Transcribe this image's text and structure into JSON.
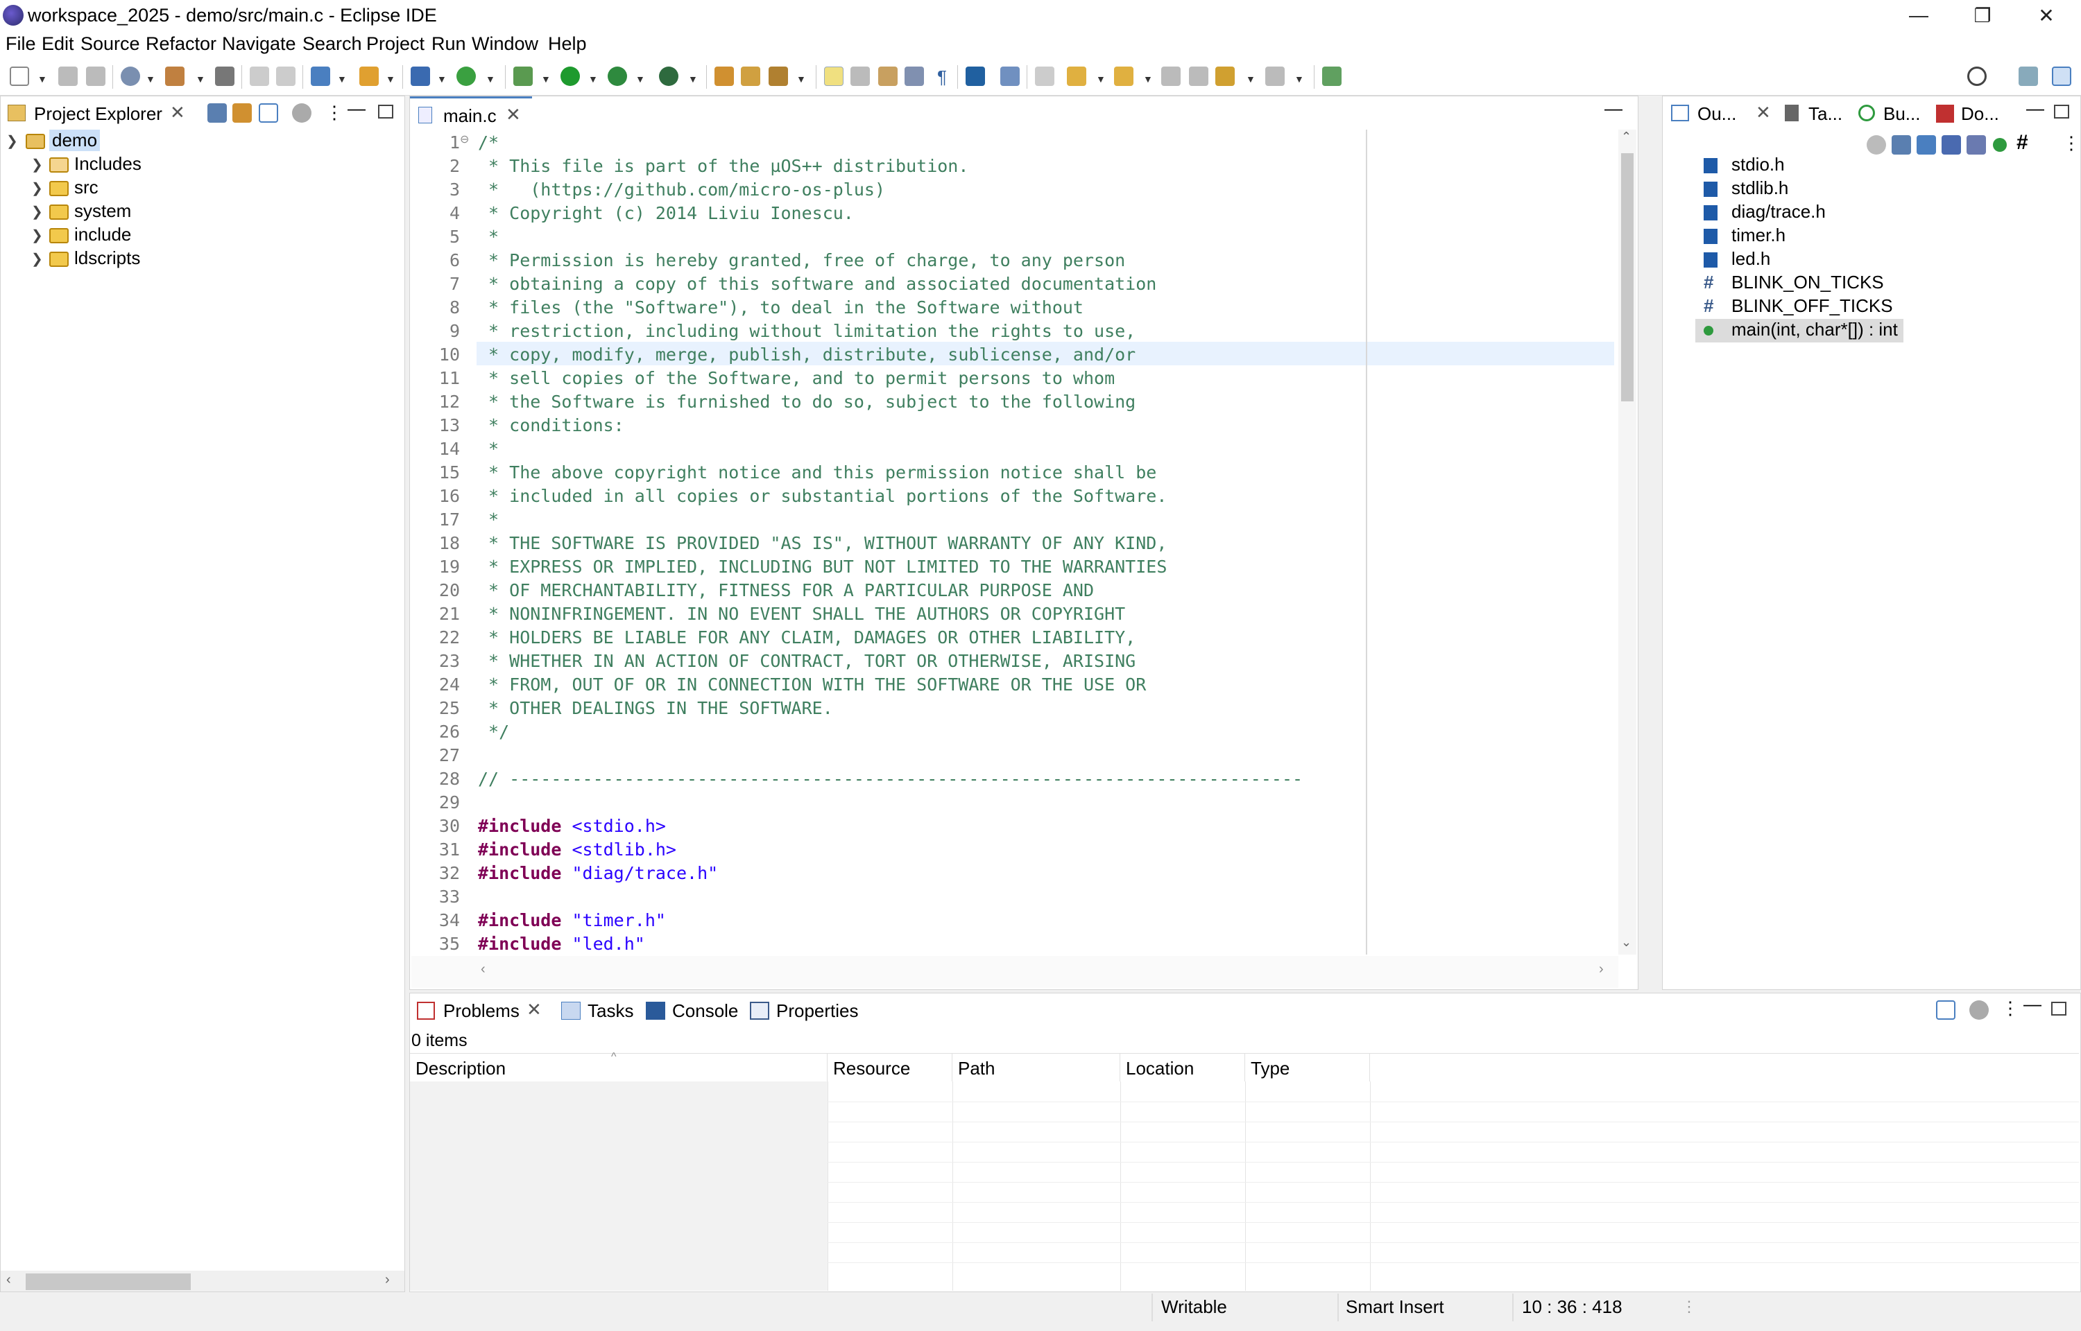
{
  "window": {
    "title": "workspace_2025 - demo/src/main.c - Eclipse IDE",
    "minimize": "—",
    "restore": "❐",
    "close": "✕"
  },
  "menu": [
    "File",
    "Edit",
    "Source",
    "Refactor",
    "Navigate",
    "Search",
    "Project",
    "Run",
    "Window",
    "Help"
  ],
  "project_explorer": {
    "tab_label": "Project Explorer",
    "tree": [
      {
        "label": "demo",
        "expanded": true
      },
      {
        "label": "Includes"
      },
      {
        "label": "src"
      },
      {
        "label": "system"
      },
      {
        "label": "include"
      },
      {
        "label": "ldscripts"
      }
    ]
  },
  "editor": {
    "tab_label": "main.c",
    "lines": [
      {
        "n": "1",
        "t": "/*",
        "c": "cmt"
      },
      {
        "n": "2",
        "t": " * This file is part of the µOS++ distribution.",
        "c": "cmt"
      },
      {
        "n": "3",
        "t": " *   (https://github.com/micro-os-plus)",
        "c": "cmt"
      },
      {
        "n": "4",
        "t": " * Copyright (c) 2014 Liviu Ionescu.",
        "c": "cmt"
      },
      {
        "n": "5",
        "t": " *",
        "c": "cmt"
      },
      {
        "n": "6",
        "t": " * Permission is hereby granted, free of charge, to any person",
        "c": "cmt"
      },
      {
        "n": "7",
        "t": " * obtaining a copy of this software and associated documentation",
        "c": "cmt"
      },
      {
        "n": "8",
        "t": " * files (the \"Software\"), to deal in the Software without",
        "c": "cmt"
      },
      {
        "n": "9",
        "t": " * restriction, including without limitation the rights to use,",
        "c": "cmt"
      },
      {
        "n": "10",
        "t": " * copy, modify, merge, publish, distribute, sublicense, and/or",
        "c": "cmt"
      },
      {
        "n": "11",
        "t": " * sell copies of the Software, and to permit persons to whom",
        "c": "cmt"
      },
      {
        "n": "12",
        "t": " * the Software is furnished to do so, subject to the following",
        "c": "cmt"
      },
      {
        "n": "13",
        "t": " * conditions:",
        "c": "cmt"
      },
      {
        "n": "14",
        "t": " *",
        "c": "cmt"
      },
      {
        "n": "15",
        "t": " * The above copyright notice and this permission notice shall be",
        "c": "cmt"
      },
      {
        "n": "16",
        "t": " * included in all copies or substantial portions of the Software.",
        "c": "cmt"
      },
      {
        "n": "17",
        "t": " *",
        "c": "cmt"
      },
      {
        "n": "18",
        "t": " * THE SOFTWARE IS PROVIDED \"AS IS\", WITHOUT WARRANTY OF ANY KIND,",
        "c": "cmt"
      },
      {
        "n": "19",
        "t": " * EXPRESS OR IMPLIED, INCLUDING BUT NOT LIMITED TO THE WARRANTIES",
        "c": "cmt"
      },
      {
        "n": "20",
        "t": " * OF MERCHANTABILITY, FITNESS FOR A PARTICULAR PURPOSE AND",
        "c": "cmt"
      },
      {
        "n": "21",
        "t": " * NONINFRINGEMENT. IN NO EVENT SHALL THE AUTHORS OR COPYRIGHT",
        "c": "cmt"
      },
      {
        "n": "22",
        "t": " * HOLDERS BE LIABLE FOR ANY CLAIM, DAMAGES OR OTHER LIABILITY,",
        "c": "cmt"
      },
      {
        "n": "23",
        "t": " * WHETHER IN AN ACTION OF CONTRACT, TORT OR OTHERWISE, ARISING",
        "c": "cmt"
      },
      {
        "n": "24",
        "t": " * FROM, OUT OF OR IN CONNECTION WITH THE SOFTWARE OR THE USE OR",
        "c": "cmt"
      },
      {
        "n": "25",
        "t": " * OTHER DEALINGS IN THE SOFTWARE.",
        "c": "cmt"
      },
      {
        "n": "26",
        "t": " */",
        "c": "cmt"
      },
      {
        "n": "27",
        "t": "",
        "c": "cmt"
      },
      {
        "n": "28",
        "t": "// ----------------------------------------------------------------------------",
        "c": "cmt"
      },
      {
        "n": "29",
        "t": "",
        "c": "cmt"
      },
      {
        "n": "30",
        "kw": "#include",
        "t": " <stdio.h>",
        "c": "str"
      },
      {
        "n": "31",
        "kw": "#include",
        "t": " <stdlib.h>",
        "c": "str"
      },
      {
        "n": "32",
        "kw": "#include",
        "t": " \"diag/trace.h\"",
        "c": "str"
      },
      {
        "n": "33",
        "t": "",
        "c": "cmt"
      },
      {
        "n": "34",
        "kw": "#include",
        "t": " \"timer.h\"",
        "c": "str"
      },
      {
        "n": "35",
        "kw": "#include",
        "t": " \"led.h\"",
        "c": "str"
      }
    ]
  },
  "outline": {
    "tabs": [
      "Ou...",
      "Ta...",
      "Bu...",
      "Do..."
    ],
    "items": [
      {
        "label": "stdio.h",
        "icon": "include-icon"
      },
      {
        "label": "stdlib.h",
        "icon": "include-icon"
      },
      {
        "label": "diag/trace.h",
        "icon": "include-icon"
      },
      {
        "label": "timer.h",
        "icon": "include-icon"
      },
      {
        "label": "led.h",
        "icon": "include-icon"
      },
      {
        "label": "BLINK_ON_TICKS",
        "icon": "macro-icon"
      },
      {
        "label": "BLINK_OFF_TICKS",
        "icon": "macro-icon"
      },
      {
        "label": "main(int, char*[]) : int",
        "icon": "function-icon",
        "selected": true
      }
    ]
  },
  "bottom": {
    "tabs": [
      "Problems",
      "Tasks",
      "Console",
      "Properties"
    ],
    "count": "0 items",
    "columns": [
      "Description",
      "Resource",
      "Path",
      "Location",
      "Type"
    ]
  },
  "status": {
    "writable": "Writable",
    "insert_mode": "Smart Insert",
    "position": "10 : 36 : 418"
  },
  "colors": {
    "comment": "#3f7f5f",
    "keyword": "#7f0055",
    "string": "#2a00ff",
    "selection": "#e8f2fe"
  }
}
